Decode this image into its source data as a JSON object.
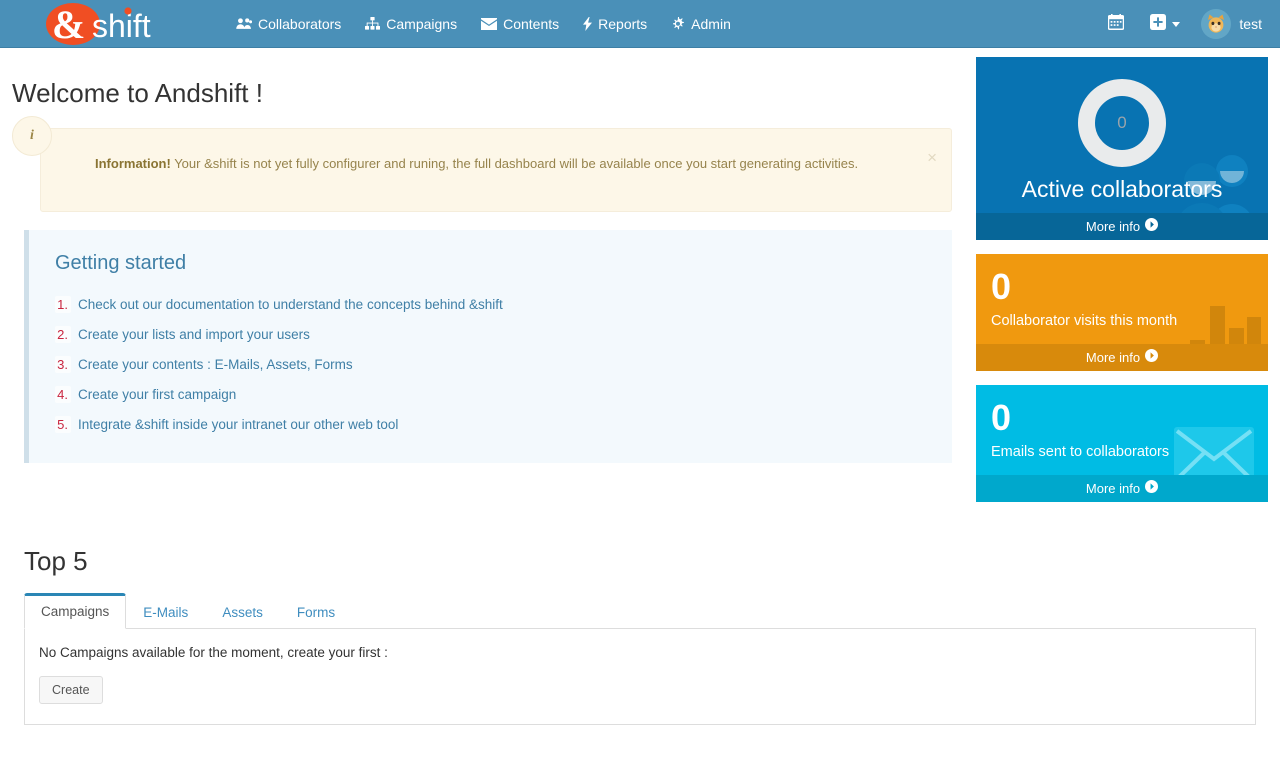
{
  "navbar": {
    "brand": {
      "amp": "&",
      "word": "shift",
      "circle_color": "#f04e23",
      "text_color": "#ffffff"
    },
    "background_color": "#4a90b8",
    "links": [
      {
        "label": "Collaborators",
        "icon": "users-icon"
      },
      {
        "label": "Campaigns",
        "icon": "sitemap-icon"
      },
      {
        "label": "Contents",
        "icon": "envelope-icon"
      },
      {
        "label": "Reports",
        "icon": "bolt-icon"
      },
      {
        "label": "Admin",
        "icon": "gear-icon"
      }
    ],
    "right": {
      "calendar_icon": "calendar-icon",
      "add_icon": "plus-square-icon",
      "add_caret": "caret-down-icon",
      "avatar_icon": "cat-face-avatar",
      "avatar_glyph": "🐱",
      "username": "test"
    }
  },
  "page": {
    "title": "Welcome to Andshift !"
  },
  "alert": {
    "icon": "info-icon",
    "icon_glyph": "i",
    "strong": "Information!",
    "message": " Your &shift is not yet fully configurer and runing, the full dashboard will be available once you start generating activities.",
    "close_label": "×",
    "background_color": "#fdf7e8",
    "text_color": "#96834c"
  },
  "getting_started": {
    "title": "Getting started",
    "accent_color": "#3f7fa6",
    "number_color": "#c9253f",
    "items": [
      {
        "num": "1.",
        "label": "Check out our documentation to understand the concepts behind &shift"
      },
      {
        "num": "2.",
        "label": "Create your lists and import your users"
      },
      {
        "num": "3.",
        "label": "Create your contents : E-Mails, Assets, Forms"
      },
      {
        "num": "4.",
        "label": "Create your first campaign"
      },
      {
        "num": "5.",
        "label": "Integrate &shift inside your intranet our other web tool"
      }
    ]
  },
  "widgets": [
    {
      "id": "active-collaborators",
      "value": "0",
      "label": "Active collaborators",
      "more_info": "More info",
      "more_info_icon": "arrow-circle-right-icon",
      "bg_icon": "users-group-icon",
      "color": "#0873b2",
      "footer_color": "#076698",
      "style": "donut"
    },
    {
      "id": "collaborator-visits",
      "value": "0",
      "label": "Collaborator visits this month",
      "more_info": "More info",
      "more_info_icon": "arrow-circle-right-icon",
      "bg_icon": "bar-chart-icon",
      "color": "#f0990f",
      "footer_color": "#d88a0c",
      "style": "plain"
    },
    {
      "id": "emails-sent",
      "value": "0",
      "label": "Emails sent to collaborators",
      "more_info": "More info",
      "more_info_icon": "arrow-circle-right-icon",
      "bg_icon": "envelope-icon",
      "color": "#00bce4",
      "footer_color": "#00a8cc",
      "style": "plain"
    }
  ],
  "top5": {
    "title": "Top 5",
    "tabs": [
      {
        "label": "Campaigns",
        "active": true
      },
      {
        "label": "E-Mails",
        "active": false
      },
      {
        "label": "Assets",
        "active": false
      },
      {
        "label": "Forms",
        "active": false
      }
    ],
    "panel": {
      "empty_text": "No Campaigns available for the moment, create your first :",
      "create_label": "Create"
    }
  }
}
